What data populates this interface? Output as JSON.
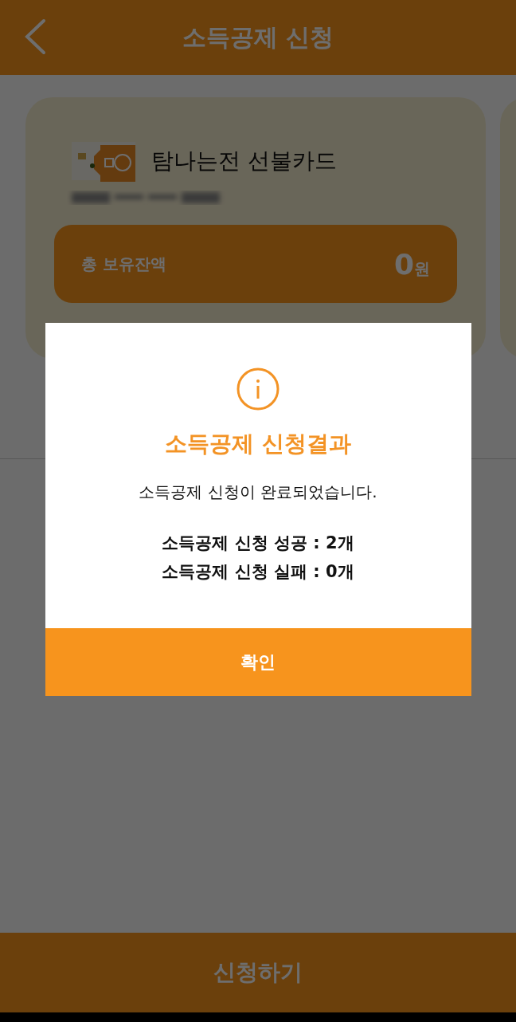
{
  "header": {
    "title": "소득공제 신청"
  },
  "card": {
    "name": "탐나는전 선불카드",
    "balance_label": "총 보유잔액",
    "balance_amount": "0",
    "balance_unit": "원"
  },
  "submit_button": "신청하기",
  "dialog": {
    "title": "소득공제 신청결과",
    "message": "소득공제 신청이 완료되었습니다.",
    "results": [
      "소득공제 신청 성공 : 2개",
      "소득공제 신청 실패 : 0개"
    ],
    "confirm": "확인"
  }
}
